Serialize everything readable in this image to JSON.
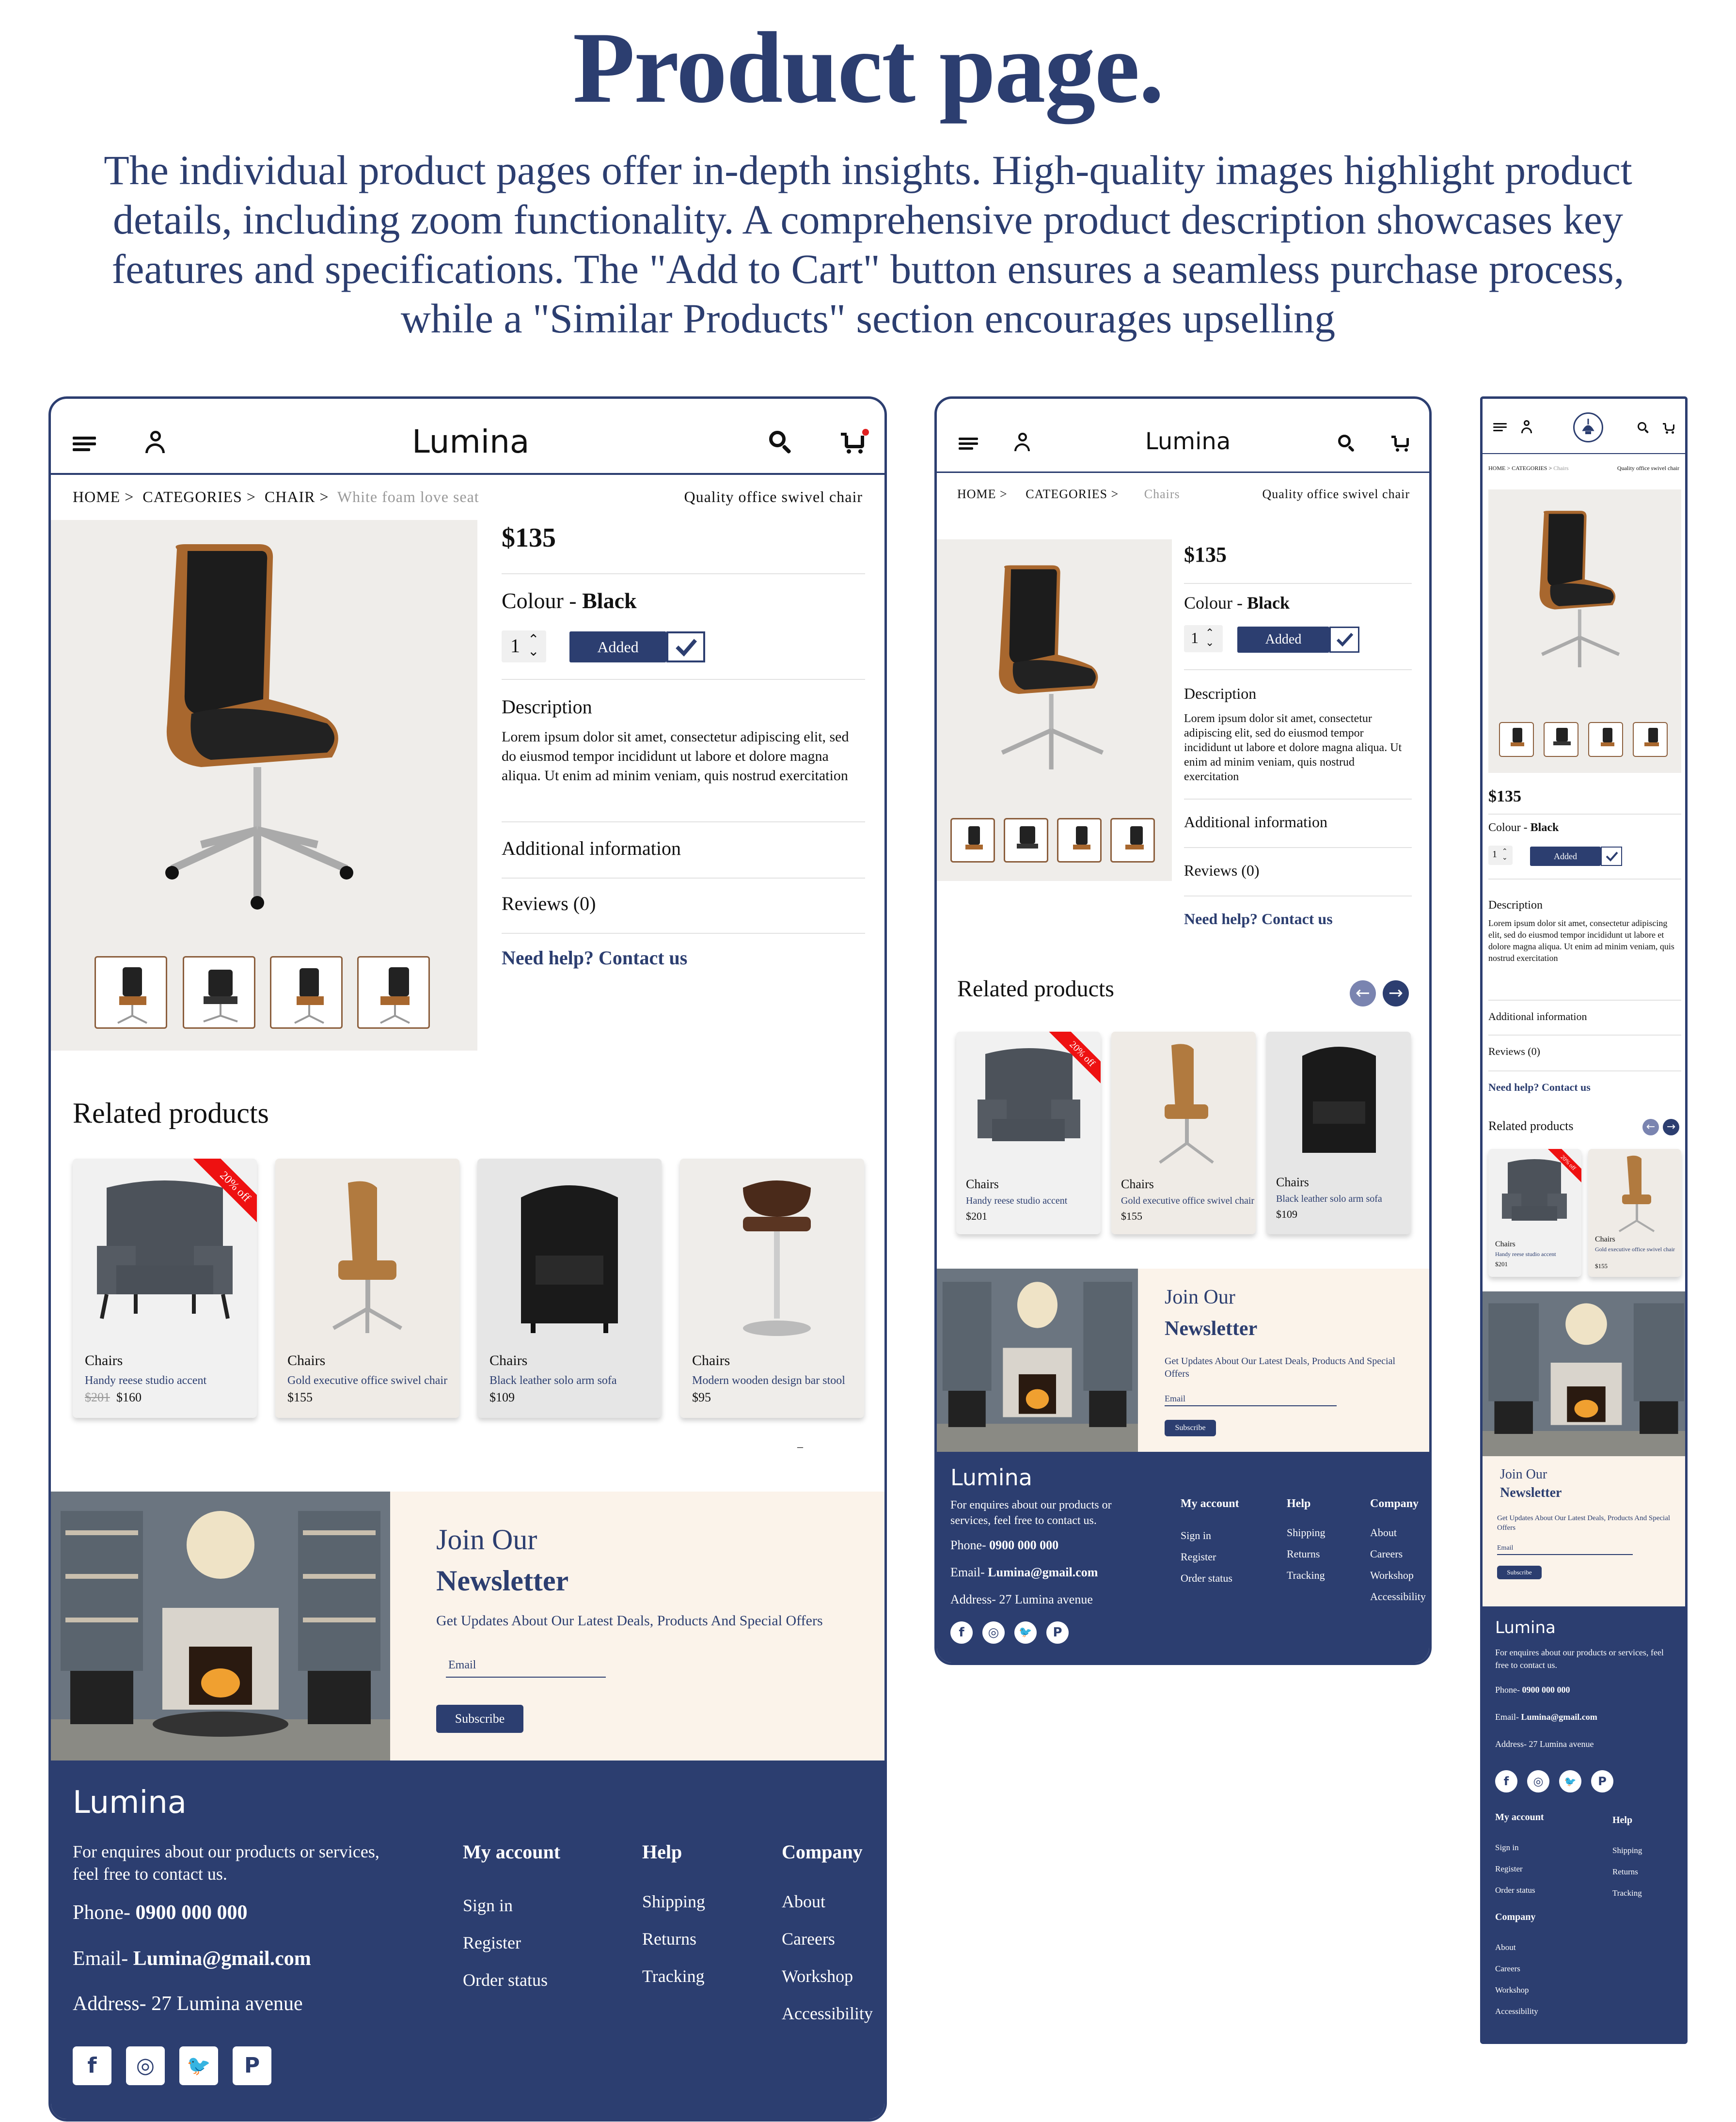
{
  "hero": {
    "title": "Product page.",
    "subtitle": "The individual product pages offer in-depth insights. High-quality images highlight product details, including zoom functionality. A comprehensive product description showcases key features and specifications. The \"Add to Cart\" button ensures a seamless purchase process, while a \"Similar Products\" section encourages upselling"
  },
  "brand": "Lumina",
  "colors": {
    "navy": "#2c3e70",
    "cream": "#fbf3ea",
    "sale_red": "#e11111",
    "bg_image": "#efedea"
  },
  "breadcrumb_desktop": {
    "home": "HOME >",
    "categories": "CATEGORIES >",
    "chair": "CHAIR >",
    "current": "White foam love seat",
    "right": "Quality office swivel chair"
  },
  "breadcrumb_tablet": {
    "home": "HOME >",
    "categories": "CATEGORIES >",
    "current": "Chairs",
    "right": "Quality office swivel chair"
  },
  "breadcrumb_mobile": {
    "home": "HOME >",
    "categories": "CATEGORIES >",
    "current": "Chairs",
    "right": "Quality office swivel chair"
  },
  "product": {
    "price": "$135",
    "colour_label": "Colour - ",
    "colour_value": "Black",
    "qty": "1",
    "added_label": "Added",
    "description_title": "Description",
    "description_text": "Lorem ipsum dolor sit amet, consectetur adipiscing elit, sed do eiusmod tempor incididunt ut labore et dolore magna aliqua. Ut enim ad minim veniam, quis nostrud exercitation",
    "additional_info": "Additional information",
    "reviews": "Reviews (0)",
    "help": "Need help? Contact us"
  },
  "related": {
    "title": "Related products",
    "items": [
      {
        "category": "Chairs",
        "name": "Handy reese studio accent",
        "old_price": "$201",
        "price": "$160",
        "badge": "20% off"
      },
      {
        "category": "Chairs",
        "name": "Gold executive office swivel chair",
        "price": "$155"
      },
      {
        "category": "Chairs",
        "name": "Black leather solo arm sofa",
        "price": "$109"
      },
      {
        "category": "Chairs",
        "name": "Modern wooden design bar stool",
        "price": "$95"
      }
    ],
    "tablet_first_price": "$201",
    "dash": "–"
  },
  "newsletter": {
    "line1": "Join Our",
    "line2": "Newsletter",
    "text": "Get Updates About Our Latest Deals, Products And Special Offers",
    "email_placeholder": "Email",
    "button": "Subscribe"
  },
  "footer": {
    "brand": "Lumina",
    "enquiry": "For enquires about our products or services, feel free to contact us.",
    "phone_label": "Phone- ",
    "phone": "0900 000 000",
    "email_label": "Email- ",
    "email": "Lumina@gmail.com",
    "address": "Address- 27 Lumina avenue",
    "my_account": {
      "title": "My account",
      "links": [
        "Sign in",
        "Register",
        "Order status"
      ]
    },
    "help": {
      "title": "Help",
      "links": [
        "Shipping",
        "Returns",
        "Tracking"
      ]
    },
    "company": {
      "title": "Company",
      "links": [
        "About",
        "Careers",
        "Workshop",
        "Accessibility"
      ]
    },
    "social": [
      "f",
      "◎",
      "🐦",
      "P"
    ]
  }
}
